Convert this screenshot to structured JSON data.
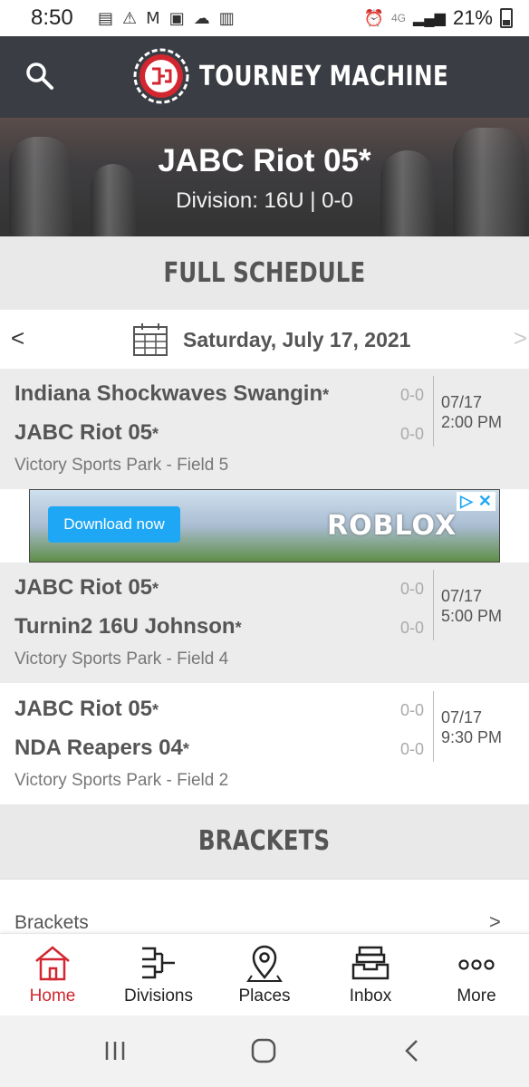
{
  "status": {
    "time": "8:50",
    "network": "4G",
    "battery": "21%"
  },
  "app": {
    "name": "TOURNEY MACHINE"
  },
  "hero": {
    "team": "JABC Riot 05*",
    "division": "Division: 16U | 0-0"
  },
  "schedule": {
    "heading": "FULL SCHEDULE",
    "date": "Saturday, July 17, 2021",
    "prev": "<",
    "next": ">",
    "games": [
      {
        "team1": "Indiana Shockwaves Swangin",
        "team2": "JABC Riot 05",
        "score1": "0-0",
        "score2": "0-0",
        "location": "Victory Sports Park - Field 5",
        "date": "07/17",
        "time": "2:00 PM"
      },
      {
        "team1": "JABC Riot 05",
        "team2": "Turnin2 16U Johnson",
        "score1": "0-0",
        "score2": "0-0",
        "location": "Victory Sports Park - Field 4",
        "date": "07/17",
        "time": "5:00 PM"
      },
      {
        "team1": "JABC Riot 05",
        "team2": "NDA Reapers 04",
        "score1": "0-0",
        "score2": "0-0",
        "location": "Victory Sports Park - Field 2",
        "date": "07/17",
        "time": "9:30 PM"
      }
    ]
  },
  "ad": {
    "button": "Download now",
    "brand": "ROBLOX"
  },
  "brackets": {
    "heading": "BRACKETS",
    "item": "Brackets",
    "chevron": ">"
  },
  "tabs": [
    {
      "label": "Home",
      "icon": "home-icon"
    },
    {
      "label": "Divisions",
      "icon": "bracket-icon"
    },
    {
      "label": "Places",
      "icon": "map-pin-icon"
    },
    {
      "label": "Inbox",
      "icon": "inbox-icon"
    },
    {
      "label": "More",
      "icon": "more-icon"
    }
  ],
  "colors": {
    "accent": "#d22630",
    "appbar": "#3a3d44",
    "section": "#e9e9e9"
  }
}
